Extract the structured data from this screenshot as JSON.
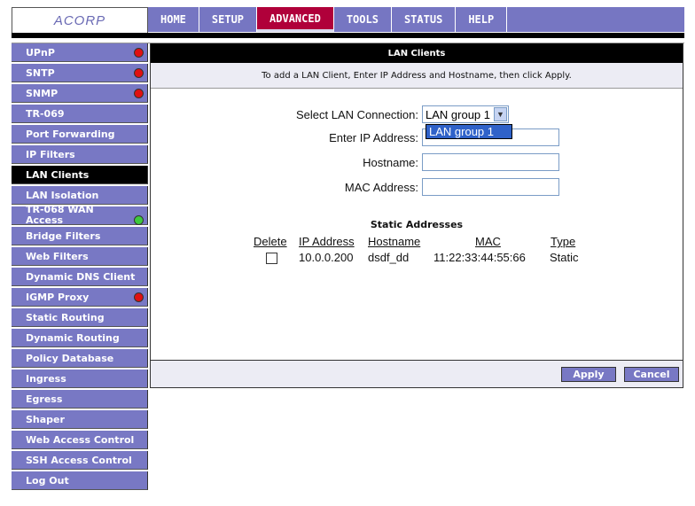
{
  "header": {
    "logo": "ACORP",
    "tabs": [
      "HOME",
      "SETUP",
      "ADVANCED",
      "TOOLS",
      "STATUS",
      "HELP"
    ],
    "active_tab": "ADVANCED"
  },
  "sidebar": {
    "items": [
      {
        "label": "UPnP",
        "status": "red"
      },
      {
        "label": "SNTP",
        "status": "red"
      },
      {
        "label": "SNMP",
        "status": "red"
      },
      {
        "label": "TR-069",
        "status": ""
      },
      {
        "label": "Port Forwarding",
        "status": ""
      },
      {
        "label": "IP Filters",
        "status": ""
      },
      {
        "label": "LAN Clients",
        "status": "",
        "active": true
      },
      {
        "label": "LAN Isolation",
        "status": ""
      },
      {
        "label": "TR-068 WAN Access",
        "status": "green"
      },
      {
        "label": "Bridge Filters",
        "status": ""
      },
      {
        "label": "Web Filters",
        "status": ""
      },
      {
        "label": "Dynamic DNS Client",
        "status": ""
      },
      {
        "label": "IGMP Proxy",
        "status": "red"
      },
      {
        "label": "Static Routing",
        "status": ""
      },
      {
        "label": "Dynamic Routing",
        "status": ""
      },
      {
        "label": "Policy Database",
        "status": ""
      },
      {
        "label": "Ingress",
        "status": ""
      },
      {
        "label": "Egress",
        "status": ""
      },
      {
        "label": "Shaper",
        "status": ""
      },
      {
        "label": "Web Access Control",
        "status": ""
      },
      {
        "label": "SSH Access Control",
        "status": ""
      },
      {
        "label": "Log Out",
        "status": ""
      }
    ]
  },
  "main": {
    "title": "LAN Clients",
    "instruction": "To add a LAN Client, Enter IP Address and Hostname, then click Apply.",
    "form": {
      "select_label": "Select LAN Connection:",
      "select_value": "LAN group 1",
      "dropdown_option": "LAN group 1",
      "ip_label": "Enter IP Address:",
      "hostname_label": "Hostname:",
      "mac_label": "MAC Address:"
    },
    "static": {
      "title": "Static Addresses",
      "headers": {
        "delete": "Delete",
        "ip": "IP Address",
        "hostname": "Hostname",
        "mac": "MAC",
        "type": "Type"
      },
      "rows": [
        {
          "ip": "10.0.0.200",
          "hostname": "dsdf_dd",
          "mac": "11:22:33:44:55:66",
          "type": "Static"
        }
      ]
    },
    "buttons": {
      "apply": "Apply",
      "cancel": "Cancel"
    }
  },
  "colors": {
    "nav": "#7676c2",
    "active_tab": "#b0003a",
    "status_red": "#e01010",
    "status_green": "#3ec93e"
  }
}
